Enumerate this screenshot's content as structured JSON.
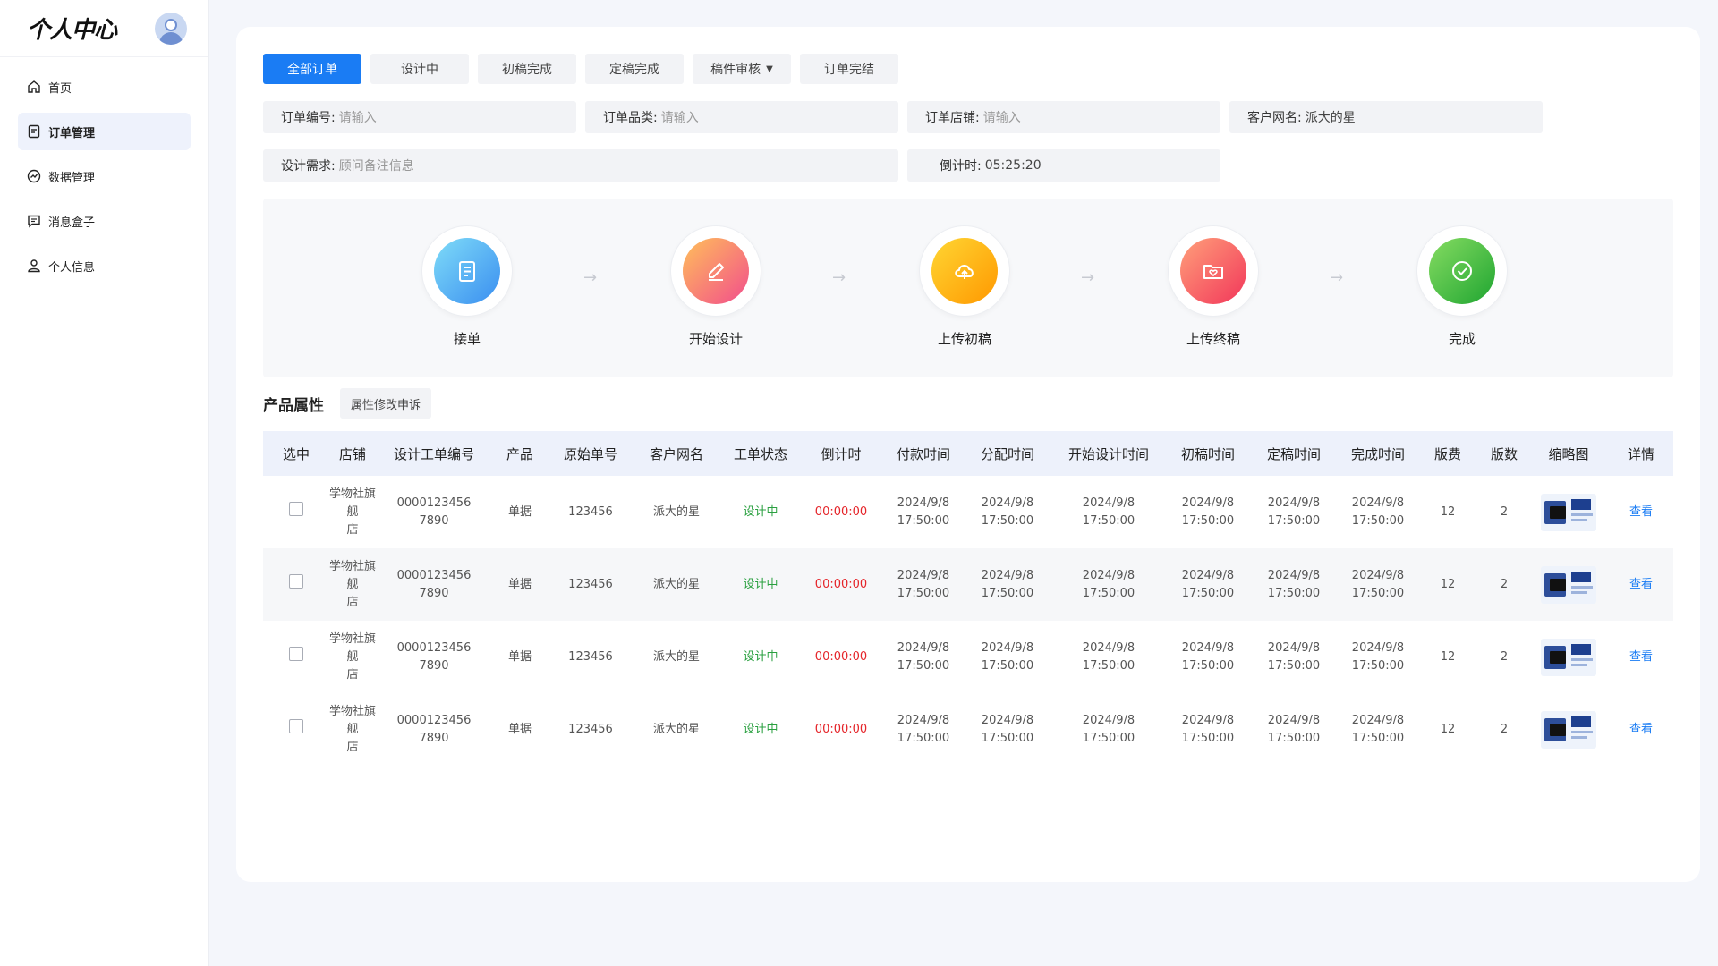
{
  "sidebar": {
    "logo": "个人中心",
    "items": [
      {
        "label": "首页",
        "icon": "home-icon"
      },
      {
        "label": "订单管理",
        "icon": "order-icon",
        "active": true
      },
      {
        "label": "数据管理",
        "icon": "chart-icon"
      },
      {
        "label": "消息盒子",
        "icon": "message-icon"
      },
      {
        "label": "个人信息",
        "icon": "user-icon"
      }
    ]
  },
  "tabs": [
    {
      "label": "全部订单",
      "active": true
    },
    {
      "label": "设计中"
    },
    {
      "label": "初稿完成"
    },
    {
      "label": "定稿完成"
    },
    {
      "label": "稿件审核",
      "dropdown": true
    },
    {
      "label": "订单完结"
    }
  ],
  "filters": {
    "order_no": {
      "label": "订单编号:",
      "placeholder": "请输入"
    },
    "category": {
      "label": "订单品类:",
      "placeholder": "请输入"
    },
    "store": {
      "label": "订单店铺:",
      "placeholder": "请输入"
    },
    "customer": {
      "label": "客户网名:",
      "value": "派大的星"
    },
    "requirement": {
      "label": "设计需求:",
      "placeholder": "顾问备注信息"
    },
    "countdown": {
      "label": "倒计时:",
      "value": "05:25:20"
    }
  },
  "steps": [
    {
      "label": "接单",
      "icon": "clipboard-icon",
      "color_from": "#6fd0f6",
      "color_to": "#3a8ef0"
    },
    {
      "label": "开始设计",
      "icon": "pencil-icon",
      "color_from": "#ffb35a",
      "color_to": "#f24d8c"
    },
    {
      "label": "上传初稿",
      "icon": "cloud-upload-icon",
      "color_from": "#ffd233",
      "color_to": "#ff9a00"
    },
    {
      "label": "上传终稿",
      "icon": "folder-heart-icon",
      "color_from": "#ff9a7a",
      "color_to": "#f2365a"
    },
    {
      "label": "完成",
      "icon": "check-circle-icon",
      "color_from": "#7ad65a",
      "color_to": "#1fa531"
    }
  ],
  "attributes": {
    "title": "产品属性",
    "appeal_button": "属性修改申诉"
  },
  "table": {
    "headers": [
      "选中",
      "店铺",
      "设计工单编号",
      "产品",
      "原始单号",
      "客户网名",
      "工单状态",
      "倒计时",
      "付款时间",
      "分配时间",
      "开始设计时间",
      "初稿时间",
      "定稿时间",
      "完成时间",
      "版费",
      "版数",
      "缩略图",
      "详情"
    ],
    "rows": [
      {
        "store_l1": "学物社旗舰",
        "store_l2": "店",
        "no_l1": "0000123456",
        "no_l2": "7890",
        "product": "单据",
        "origin": "123456",
        "customer": "派大的星",
        "status": "设计中",
        "timer": "00:00:00",
        "date": "2024/9/8",
        "time": "17:50:00",
        "fee": "12",
        "count": "2",
        "detail": "查看"
      },
      {
        "store_l1": "学物社旗舰",
        "store_l2": "店",
        "no_l1": "0000123456",
        "no_l2": "7890",
        "product": "单据",
        "origin": "123456",
        "customer": "派大的星",
        "status": "设计中",
        "timer": "00:00:00",
        "date": "2024/9/8",
        "time": "17:50:00",
        "fee": "12",
        "count": "2",
        "detail": "查看"
      },
      {
        "store_l1": "学物社旗舰",
        "store_l2": "店",
        "no_l1": "0000123456",
        "no_l2": "7890",
        "product": "单据",
        "origin": "123456",
        "customer": "派大的星",
        "status": "设计中",
        "timer": "00:00:00",
        "date": "2024/9/8",
        "time": "17:50:00",
        "fee": "12",
        "count": "2",
        "detail": "查看"
      },
      {
        "store_l1": "学物社旗舰",
        "store_l2": "店",
        "no_l1": "0000123456",
        "no_l2": "7890",
        "product": "单据",
        "origin": "123456",
        "customer": "派大的星",
        "status": "设计中",
        "timer": "00:00:00",
        "date": "2024/9/8",
        "time": "17:50:00",
        "fee": "12",
        "count": "2",
        "detail": "查看"
      }
    ]
  },
  "colors": {
    "accent": "#1a7cf4",
    "status_green": "#2aa040",
    "timer_red": "#e5252a"
  }
}
